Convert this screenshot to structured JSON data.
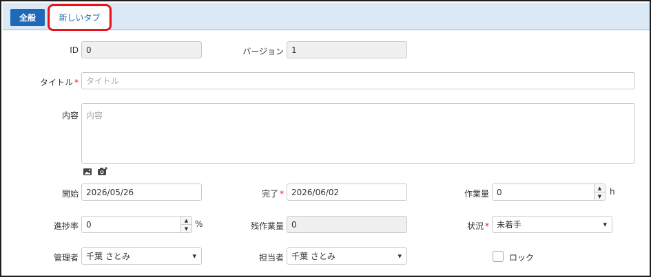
{
  "tabs": {
    "main_label": "全般",
    "new_label": "新しいタブ"
  },
  "fields": {
    "id": {
      "label": "ID",
      "value": "0"
    },
    "version": {
      "label": "バージョン",
      "value": "1"
    },
    "title": {
      "label": "タイトル",
      "placeholder": "タイトル",
      "required_mark": "*"
    },
    "content": {
      "label": "内容",
      "placeholder": "内容"
    },
    "start": {
      "label": "開始",
      "value": "2026/05/26"
    },
    "end": {
      "label": "完了",
      "value": "2026/06/02",
      "required_mark": "*"
    },
    "workload": {
      "label": "作業量",
      "value": "0",
      "unit": "h"
    },
    "progress": {
      "label": "進捗率",
      "value": "0",
      "unit": "%"
    },
    "remaining": {
      "label": "残作業量",
      "value": "0"
    },
    "status": {
      "label": "状況",
      "value": "未着手",
      "required_mark": "*"
    },
    "manager": {
      "label": "管理者",
      "value": "千葉 さとみ"
    },
    "assignee": {
      "label": "担当者",
      "value": "千葉 さとみ"
    },
    "lock": {
      "label": "ロック",
      "checked": false
    }
  },
  "colors": {
    "accent": "#1e6ab8",
    "tabbar_bg": "#dbe8f5",
    "highlight": "#e8141b"
  },
  "icons": {
    "image": "image-icon",
    "camera": "camera-icon",
    "spin_up": "spin-up-icon",
    "spin_down": "spin-down-icon",
    "select": "chevron-down-icon"
  }
}
